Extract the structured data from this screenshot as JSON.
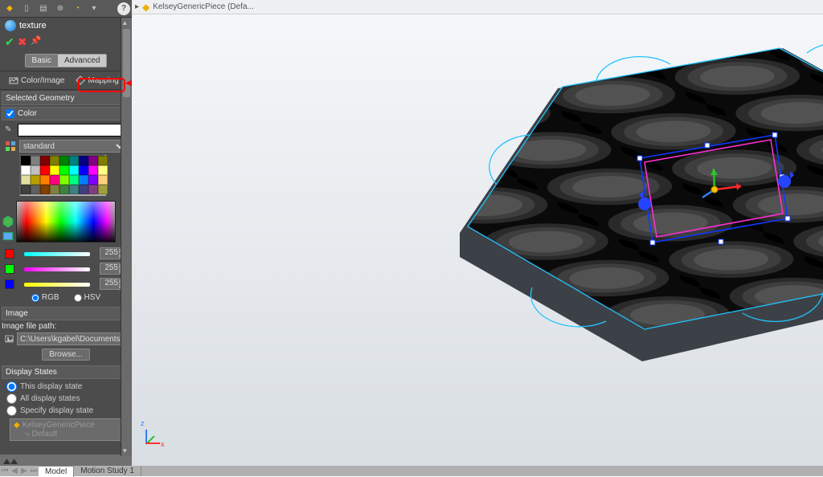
{
  "breadcrumb": {
    "item": "KelseyGenericPiece  (Defa..."
  },
  "panel": {
    "title": "texture",
    "pill_basic": "Basic",
    "pill_advanced": "Advanced",
    "tab_color_image": "Color/Image",
    "tab_mapping": "Mapping",
    "section_geometry": "Selected Geometry",
    "section_color": "Color",
    "swatch_dropdown": "standard",
    "rgb": {
      "r": "255",
      "g": "255",
      "b": "255"
    },
    "mode_rgb": "RGB",
    "mode_hsv": "HSV",
    "section_image": "Image",
    "image_path_label": "Image file path:",
    "image_path_value": "C:\\Users\\kgabel\\Documents\\Bl",
    "browse": "Browse...",
    "section_display_states": "Display States",
    "ds_this": "This display state",
    "ds_all": "All display states",
    "ds_specify": "Specify display state",
    "tree_root": "KelseyGenericPiece",
    "tree_child": "Default"
  },
  "bottom_tabs": {
    "model": "Model",
    "motion": "Motion Study 1"
  },
  "triad": {
    "x": "x",
    "z": "z"
  },
  "swatch_rows": [
    [
      "#000000",
      "#808080",
      "#800000",
      "#808000",
      "#008000",
      "#008080",
      "#000080",
      "#800080",
      "#7f7f00"
    ],
    [
      "#ffffff",
      "#c0c0c0",
      "#ff0000",
      "#ffff00",
      "#00ff00",
      "#00ffff",
      "#0000ff",
      "#ff00ff",
      "#ffff80"
    ],
    [
      "#e0e0a0",
      "#b8a000",
      "#ff8000",
      "#ff0080",
      "#80ff00",
      "#00ff80",
      "#0080ff",
      "#8000ff",
      "#ffd080"
    ],
    [
      "#404040",
      "#606060",
      "#804000",
      "#808040",
      "#408040",
      "#408080",
      "#404080",
      "#804080",
      "#a0a040"
    ]
  ]
}
